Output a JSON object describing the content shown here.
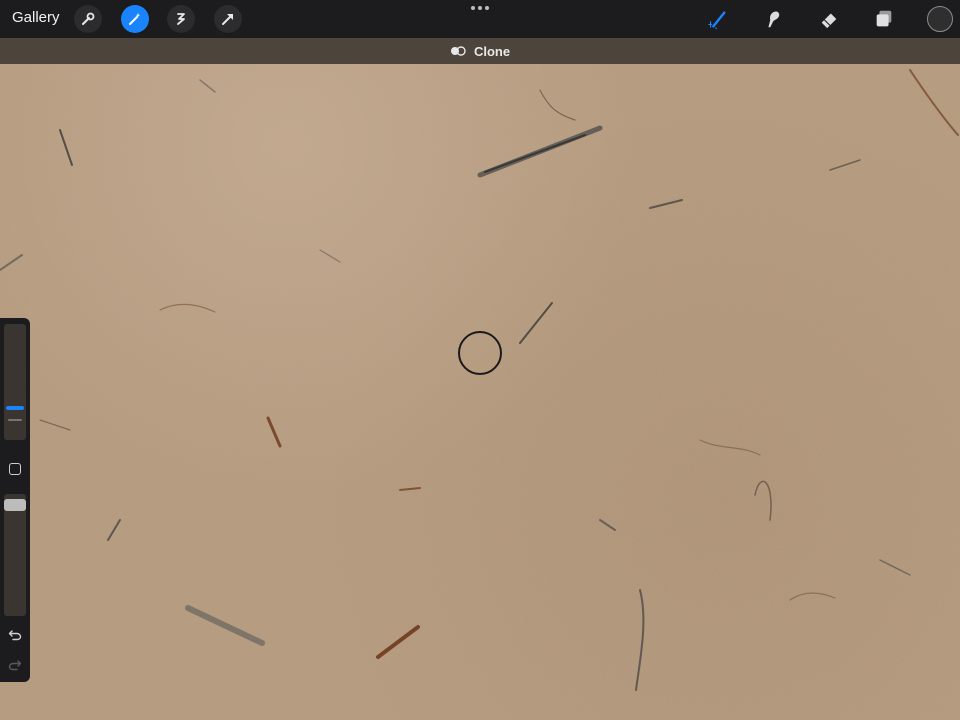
{
  "top_bar": {
    "gallery_label": "Gallery",
    "left_tools": [
      {
        "name": "wrench-icon"
      },
      {
        "name": "magic-wand-icon",
        "active": true
      },
      {
        "name": "selection-icon"
      },
      {
        "name": "transform-arrow-icon"
      }
    ],
    "right_tools": [
      "brush-icon",
      "smudge-icon",
      "eraser-icon",
      "layers-icon"
    ],
    "color_swatch": "#2f2f2f"
  },
  "mode_bar": {
    "label": "Clone",
    "icon": "clone-toggle-icon"
  },
  "sidebar": {
    "size_slider": "brush-size-slider",
    "opacity_slider": "opacity-slider",
    "modify_button": "square-icon",
    "undo_icon": "undo-icon",
    "redo_icon": "redo-icon"
  },
  "colors": {
    "accent": "#1a84ff",
    "toolbar_bg": "#1c1c1e",
    "mode_bar_bg": "#4d443c",
    "canvas_paper": "#b3987c"
  }
}
